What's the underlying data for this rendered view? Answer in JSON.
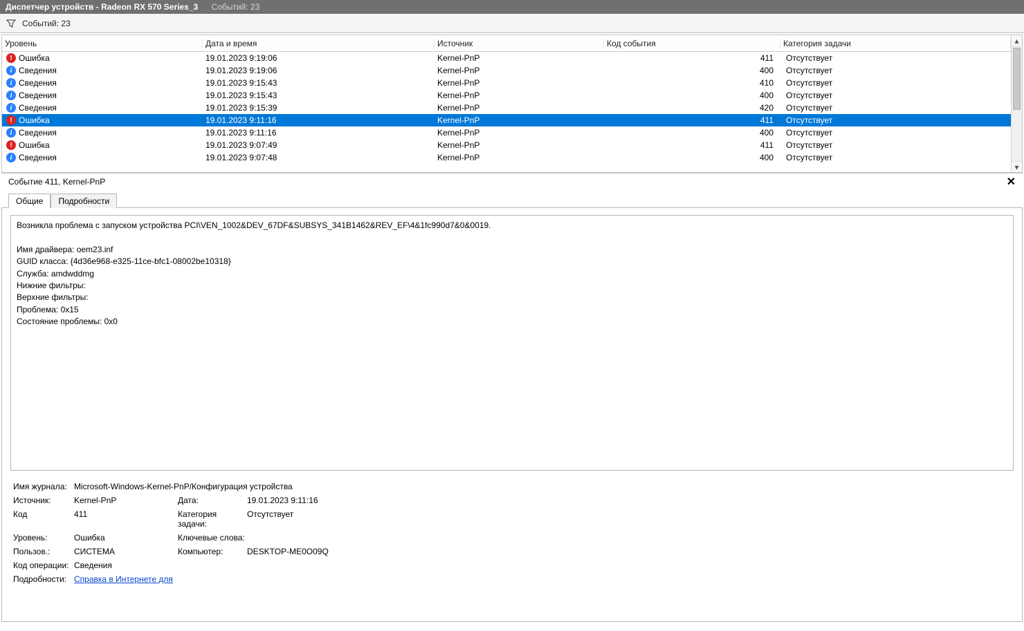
{
  "title": {
    "main": "Диспетчер устройств - Radeon RX 570 Series_3",
    "events": "Событий: 23"
  },
  "toolbar": {
    "events": "Событий: 23"
  },
  "columns": {
    "level": "Уровень",
    "date": "Дата и время",
    "source": "Источник",
    "code": "Код события",
    "category": "Категория задачи"
  },
  "levels": {
    "error": "Ошибка",
    "info": "Сведения"
  },
  "rows": [
    {
      "lvl": "error",
      "date": "19.01.2023 9:19:06",
      "src": "Kernel-PnP",
      "code": "411",
      "cat": "Отсутствует"
    },
    {
      "lvl": "info",
      "date": "19.01.2023 9:19:06",
      "src": "Kernel-PnP",
      "code": "400",
      "cat": "Отсутствует"
    },
    {
      "lvl": "info",
      "date": "19.01.2023 9:15:43",
      "src": "Kernel-PnP",
      "code": "410",
      "cat": "Отсутствует"
    },
    {
      "lvl": "info",
      "date": "19.01.2023 9:15:43",
      "src": "Kernel-PnP",
      "code": "400",
      "cat": "Отсутствует"
    },
    {
      "lvl": "info",
      "date": "19.01.2023 9:15:39",
      "src": "Kernel-PnP",
      "code": "420",
      "cat": "Отсутствует"
    },
    {
      "lvl": "error",
      "date": "19.01.2023 9:11:16",
      "src": "Kernel-PnP",
      "code": "411",
      "cat": "Отсутствует",
      "selected": true
    },
    {
      "lvl": "info",
      "date": "19.01.2023 9:11:16",
      "src": "Kernel-PnP",
      "code": "400",
      "cat": "Отсутствует"
    },
    {
      "lvl": "error",
      "date": "19.01.2023 9:07:49",
      "src": "Kernel-PnP",
      "code": "411",
      "cat": "Отсутствует"
    },
    {
      "lvl": "info",
      "date": "19.01.2023 9:07:48",
      "src": "Kernel-PnP",
      "code": "400",
      "cat": "Отсутствует"
    }
  ],
  "detail": {
    "header": "Событие 411, Kernel-PnP",
    "tabs": {
      "general": "Общие",
      "details": "Подробности"
    },
    "body": "Возникла проблема с запуском устройства PCI\\VEN_1002&DEV_67DF&SUBSYS_341B1462&REV_EF\\4&1fc990d7&0&0019.\n\nИмя драйвера: oem23.inf\nGUID класса: {4d36e968-e325-11ce-bfc1-08002be10318}\nСлужба: amdwddmg\nНижние фильтры: \nВерхние фильтры: \nПроблема: 0x15\nСостояние проблемы: 0x0",
    "props": {
      "log_label": "Имя журнала:",
      "log": "Microsoft-Windows-Kernel-PnP/Конфигурация устройства",
      "source_label": "Источник:",
      "source": "Kernel-PnP",
      "date_label": "Дата:",
      "date": "19.01.2023 9:11:16",
      "code_label": "Код",
      "code": "411",
      "cat_label": "Категория задачи:",
      "cat": "Отсутствует",
      "level_label": "Уровень:",
      "level": "Ошибка",
      "kw_label": "Ключевые слова:",
      "kw": "",
      "user_label": "Пользов.:",
      "user": "СИСТЕМА",
      "comp_label": "Компьютер:",
      "comp": "DESKTOP-ME0O09Q",
      "op_label": "Код операции:",
      "op": "Сведения",
      "more_label": "Подробности:",
      "more_link": "Справка в Интернете для "
    }
  }
}
